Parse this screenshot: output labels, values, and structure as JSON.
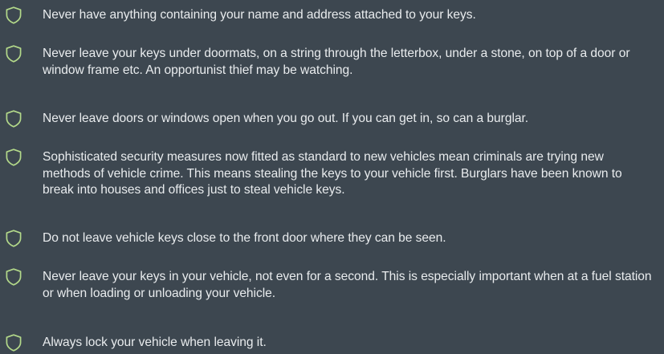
{
  "tips": [
    {
      "icon": "shield-icon",
      "text": "Never have anything containing your name and address attached to your keys."
    },
    {
      "icon": "shield-icon",
      "text": "Never leave your keys under doormats, on a string through the letterbox, under a stone, on top of a door or window frame etc. An opportunist thief may be watching."
    },
    {
      "icon": "shield-icon",
      "text": "Never leave doors or windows open when you go out. If you can get in, so can a burglar."
    },
    {
      "icon": "shield-icon",
      "text": "Sophisticated security measures now fitted as standard to new vehicles mean criminals are trying new methods of vehicle crime. This means stealing the keys to your vehicle first. Burglars have been known to break into houses and offices just to steal vehicle keys."
    },
    {
      "icon": "shield-icon",
      "text": "Do not leave vehicle keys close to the front door where they can be seen."
    },
    {
      "icon": "shield-icon",
      "text": "Never leave your keys in your vehicle, not even for a second. This is especially important when at a fuel station or when loading or unloading your vehicle."
    },
    {
      "icon": "shield-icon",
      "text": "Always lock your vehicle when leaving it."
    }
  ],
  "colors": {
    "background": "#3d4750",
    "text": "#e9ecee",
    "shield_outline": "#b3d98a"
  }
}
